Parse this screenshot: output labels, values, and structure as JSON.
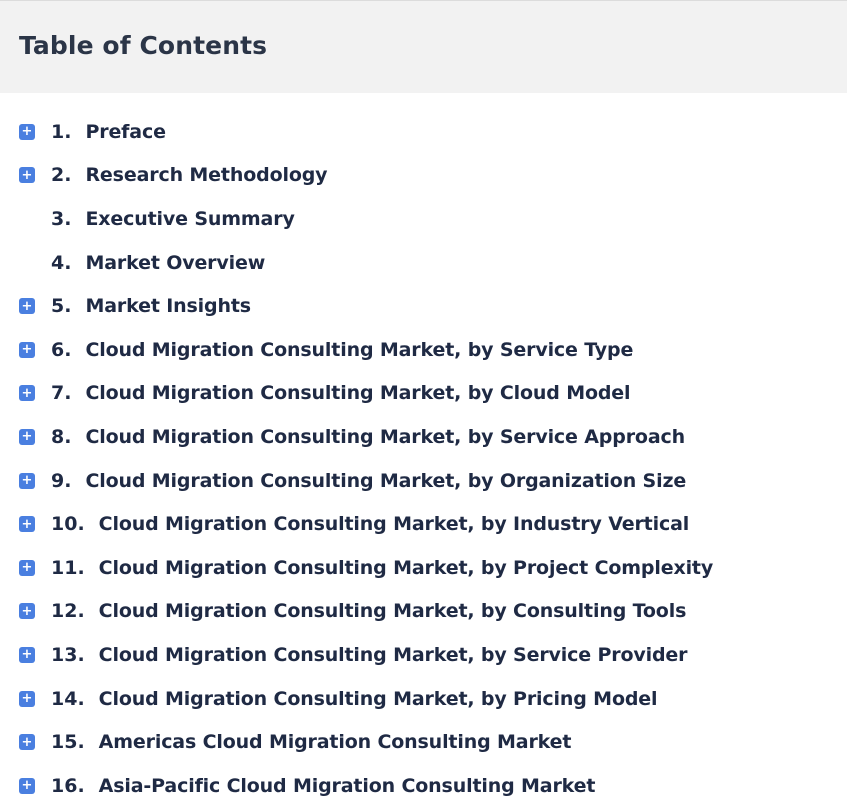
{
  "header": {
    "title": "Table of Contents"
  },
  "icons": {
    "expand": "plus-square-icon",
    "expand_glyph": "+"
  },
  "colors": {
    "icon_bg": "#4a7fe0",
    "header_bg": "#f2f2f2",
    "text": "#1f2a44"
  },
  "toc": {
    "items": [
      {
        "number": "1.",
        "label": "Preface",
        "expandable": true
      },
      {
        "number": "2.",
        "label": "Research Methodology",
        "expandable": true
      },
      {
        "number": "3.",
        "label": "Executive Summary",
        "expandable": false
      },
      {
        "number": "4.",
        "label": "Market Overview",
        "expandable": false
      },
      {
        "number": "5.",
        "label": "Market Insights",
        "expandable": true
      },
      {
        "number": "6.",
        "label": "Cloud Migration Consulting Market, by Service Type",
        "expandable": true
      },
      {
        "number": "7.",
        "label": "Cloud Migration Consulting Market, by Cloud Model",
        "expandable": true
      },
      {
        "number": "8.",
        "label": "Cloud Migration Consulting Market, by Service Approach",
        "expandable": true
      },
      {
        "number": "9.",
        "label": "Cloud Migration Consulting Market, by Organization Size",
        "expandable": true
      },
      {
        "number": "10.",
        "label": "Cloud Migration Consulting Market, by Industry Vertical",
        "expandable": true
      },
      {
        "number": "11.",
        "label": "Cloud Migration Consulting Market, by Project Complexity",
        "expandable": true
      },
      {
        "number": "12.",
        "label": "Cloud Migration Consulting Market, by Consulting Tools",
        "expandable": true
      },
      {
        "number": "13.",
        "label": "Cloud Migration Consulting Market, by Service Provider",
        "expandable": true
      },
      {
        "number": "14.",
        "label": "Cloud Migration Consulting Market, by Pricing Model",
        "expandable": true
      },
      {
        "number": "15.",
        "label": "Americas Cloud Migration Consulting Market",
        "expandable": true
      },
      {
        "number": "16.",
        "label": "Asia-Pacific Cloud Migration Consulting Market",
        "expandable": true
      }
    ]
  }
}
